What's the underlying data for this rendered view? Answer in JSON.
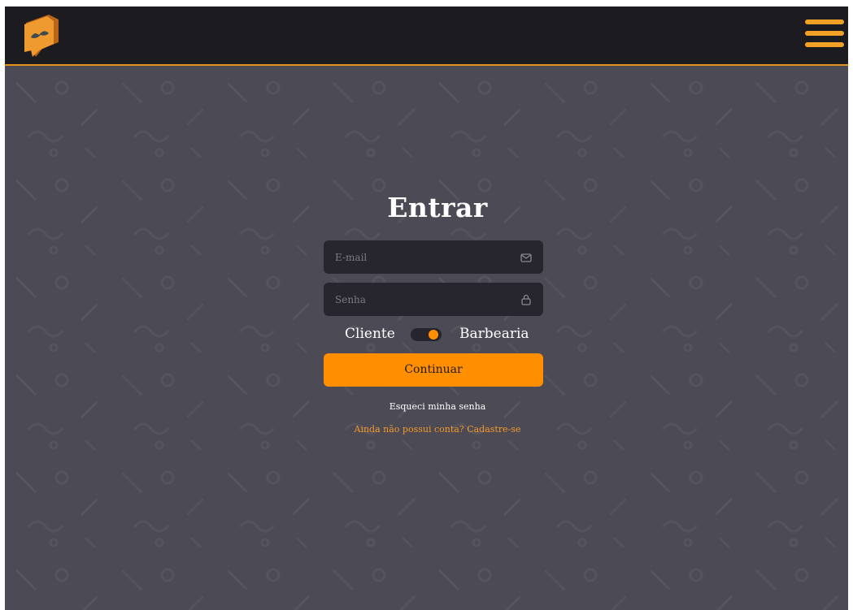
{
  "header": {
    "logo_icon": "mustache-chat-bubble-logo",
    "menu_icon": "hamburger-menu-icon",
    "accent_color": "#e8921e"
  },
  "login": {
    "title": "Entrar",
    "email": {
      "value": "",
      "placeholder": "E-mail",
      "icon": "mail-icon"
    },
    "password": {
      "value": "",
      "placeholder": "Senha",
      "icon": "lock-icon"
    },
    "toggle": {
      "left_label": "Cliente",
      "right_label": "Barbearia",
      "selected": "Barbearia"
    },
    "submit_label": "Continuar",
    "forgot_link": "Esqueci minha senha",
    "signup_link": "Ainda não possui conta? Cadastre-se"
  },
  "colors": {
    "background": "#4c4a54",
    "header": "#1c1b20",
    "field": "#27252e",
    "primary": "#ff8f00",
    "link": "#f29a2b"
  }
}
